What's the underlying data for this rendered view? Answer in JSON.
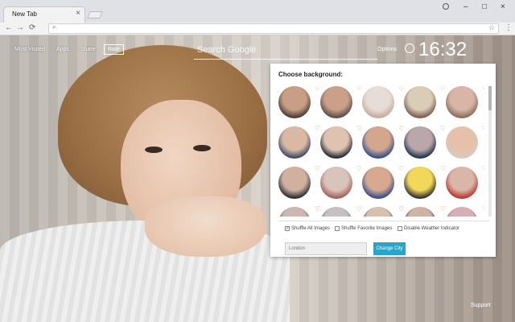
{
  "browser": {
    "tab_title": "New Tab",
    "tab_close": "×",
    "omnibox_placeholder": "",
    "window_minimize": "–",
    "window_maximize": "□",
    "window_close": "×"
  },
  "page_nav": {
    "links": [
      "Most Visited",
      "Apps",
      "Share"
    ],
    "rate": "Rate"
  },
  "search": {
    "placeholder": "Search Google"
  },
  "options": "Options",
  "clock": "16:32",
  "support": "Support",
  "panel": {
    "title": "Choose background:",
    "thumbs": [
      {
        "c1": "#c89e86",
        "c2": "#4a3a33"
      },
      {
        "c1": "#caa089",
        "c2": "#5b4b44"
      },
      {
        "c1": "#e6ddd6",
        "c2": "#c3ab9a"
      },
      {
        "c1": "#d9cdb7",
        "c2": "#7b5a4c"
      },
      {
        "c1": "#d8b5a6",
        "c2": "#8b6a5c"
      },
      {
        "c1": "#d9b9a4",
        "c2": "#3e4764"
      },
      {
        "c1": "#e0c2b0",
        "c2": "#222833"
      },
      {
        "c1": "#d3a68e",
        "c2": "#2d4e8c"
      },
      {
        "c1": "#b9a7aa",
        "c2": "#20324f"
      },
      {
        "c1": "#e6c0a8",
        "c2": "#d8c9c0"
      },
      {
        "c1": "#cfb1a0",
        "c2": "#2a2a2a"
      },
      {
        "c1": "#d9c4bb",
        "c2": "#a35c5c"
      },
      {
        "c1": "#d9a98f",
        "c2": "#334c8a"
      },
      {
        "c1": "#f2d85a",
        "c2": "#2d2d2d"
      },
      {
        "c1": "#d9b6a7",
        "c2": "#b9342e"
      },
      {
        "c1": "#cdb7b0",
        "c2": "#3b3b3b"
      },
      {
        "c1": "#c8bfc3",
        "c2": "#5d5068"
      },
      {
        "c1": "#d8c0b1",
        "c2": "#2e2b2b"
      },
      {
        "c1": "#cdb4a4",
        "c2": "#111111"
      },
      {
        "c1": "#d7b0b7",
        "c2": "#a0504e"
      }
    ],
    "heart": "♡",
    "checkboxes": [
      {
        "label": "Shuffle All Images",
        "checked": true
      },
      {
        "label": "Shuffle Favorite Images",
        "checked": false
      },
      {
        "label": "Disable Weather Indicator",
        "checked": false
      }
    ],
    "city_placeholder": "London",
    "change_city": "Change City"
  }
}
